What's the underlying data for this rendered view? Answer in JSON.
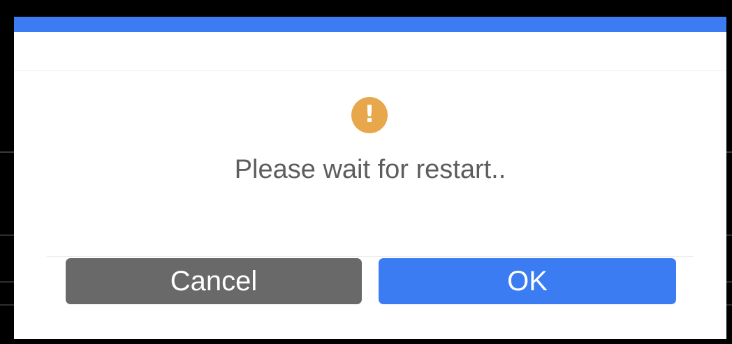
{
  "dialog": {
    "icon": "warning-icon",
    "icon_glyph": "!",
    "message": "Please wait for restart..",
    "buttons": {
      "cancel_label": "Cancel",
      "ok_label": "OK"
    }
  },
  "colors": {
    "accent": "#3b7cf2",
    "warning": "#e8a74a",
    "cancel": "#696969",
    "text": "#5d5d5d"
  }
}
